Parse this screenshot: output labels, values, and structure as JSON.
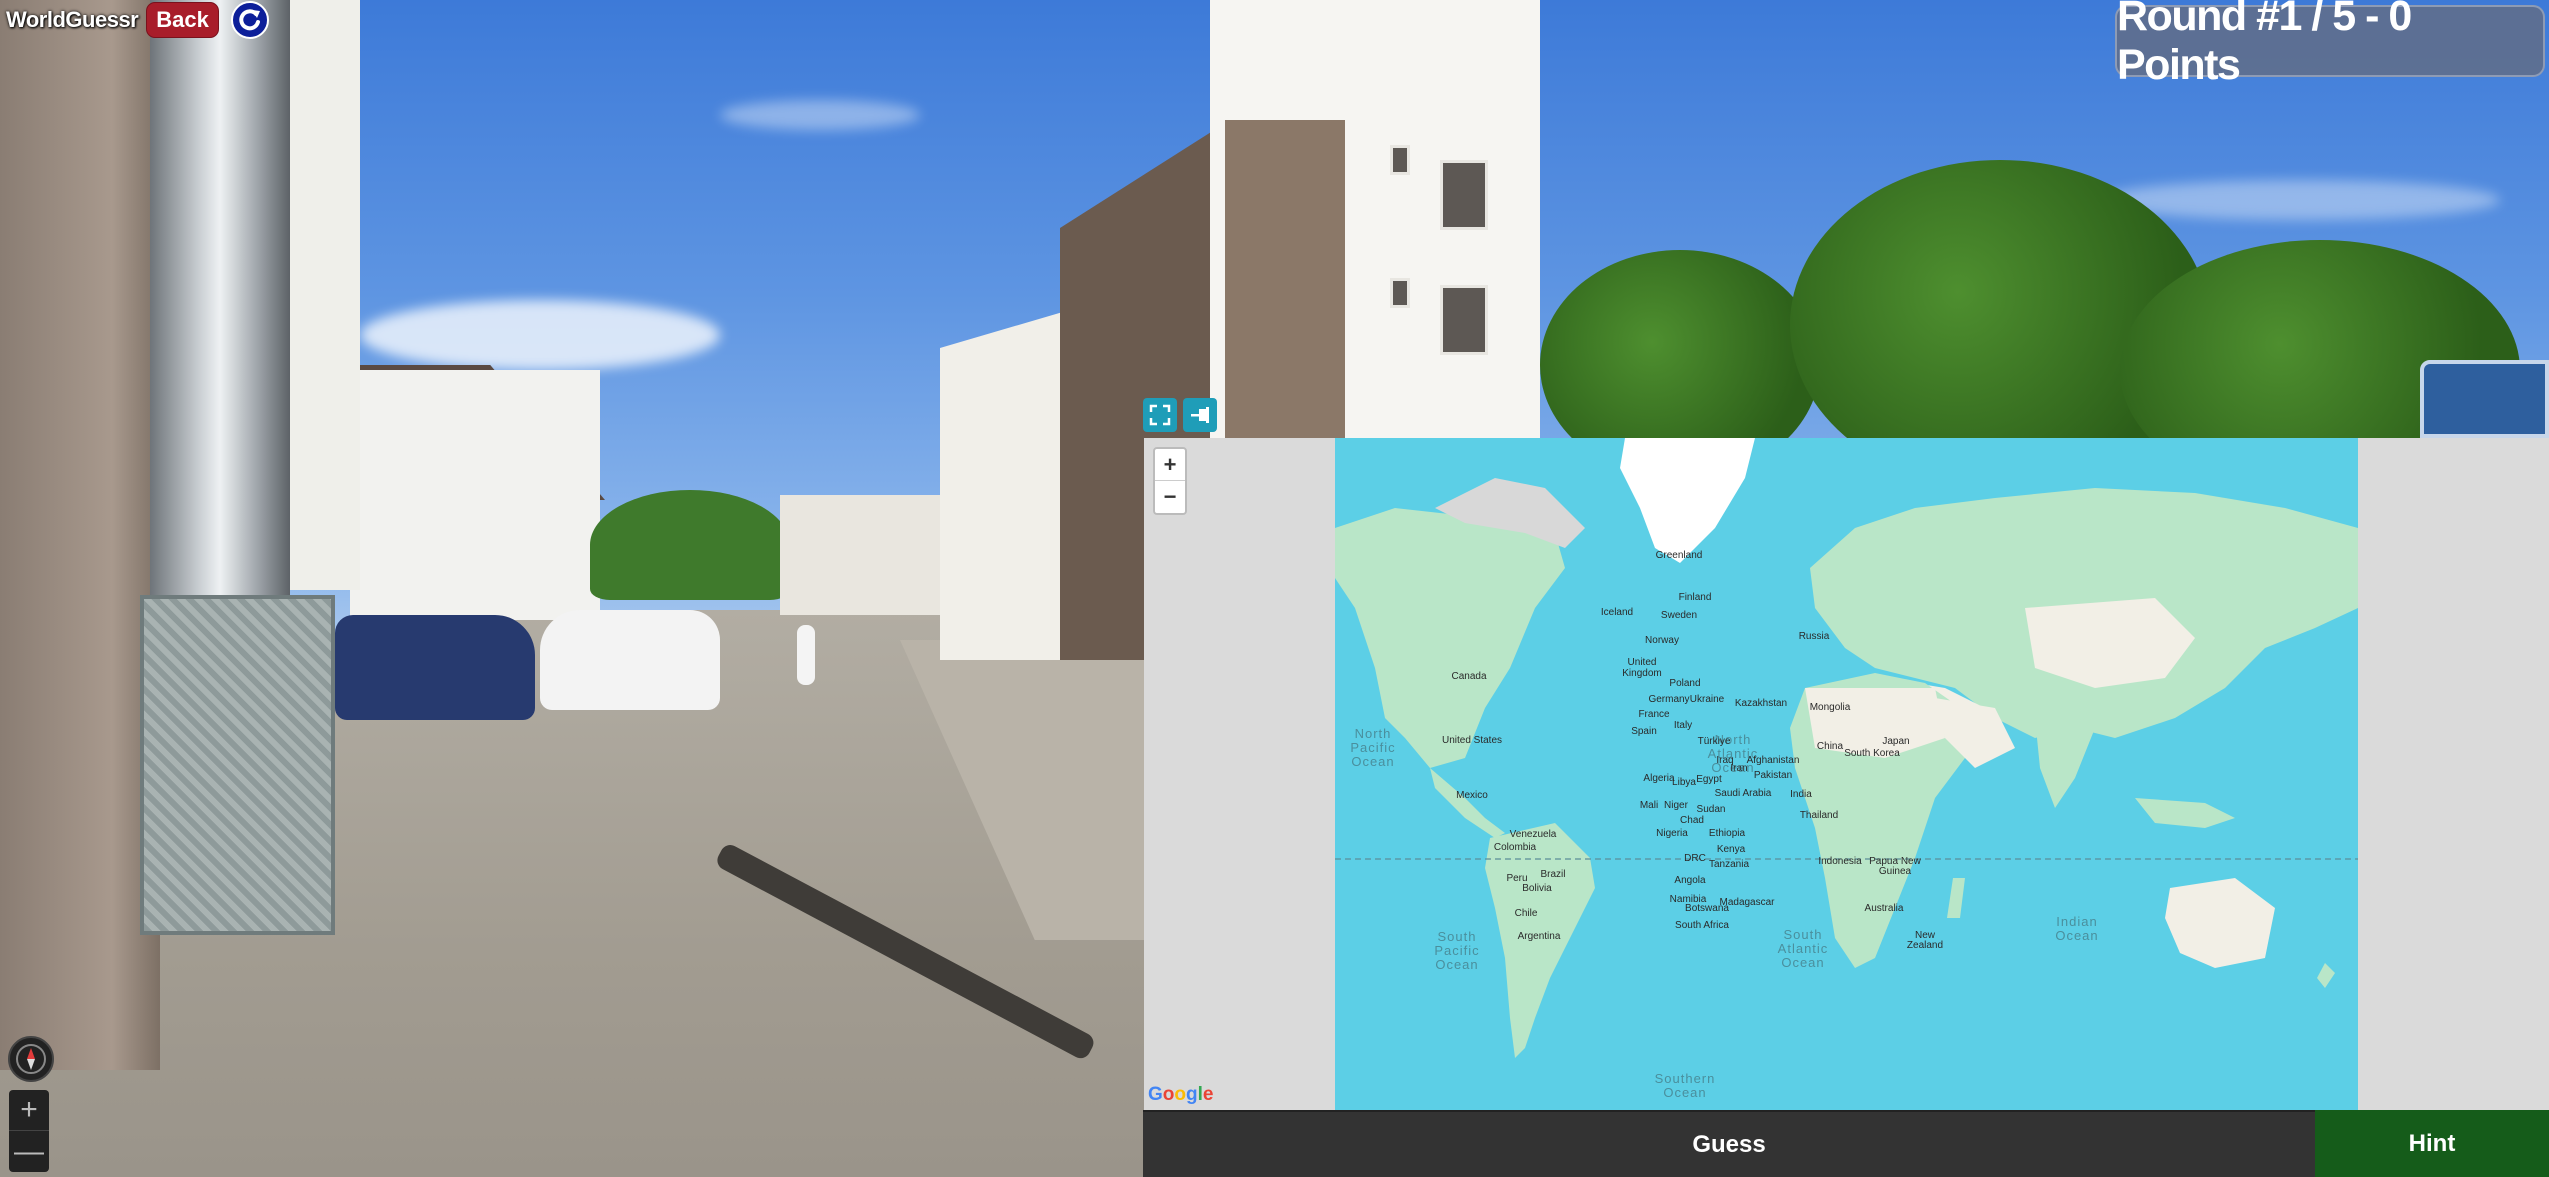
{
  "navbar": {
    "brand": "WorldGuessr",
    "back_label": "Back",
    "refresh_icon": "refresh-icon"
  },
  "round": {
    "label": "Round #1 / 5 - 0 Points"
  },
  "map": {
    "zoom_in": "+",
    "zoom_out": "−",
    "tools": [
      "fullscreen-icon",
      "pin-icon"
    ],
    "attribution": [
      "G",
      "o",
      "o",
      "g",
      "l",
      "e"
    ],
    "oceans": {
      "north_pacific": [
        "North",
        "Pacific",
        "Ocean"
      ],
      "north_atlantic": [
        "North",
        "Atlantic",
        "Ocean"
      ],
      "south_pacific": [
        "South",
        "Pacific",
        "Ocean"
      ],
      "south_atlantic": [
        "South",
        "Atlantic",
        "Ocean"
      ],
      "indian": [
        "Indian",
        "Ocean"
      ],
      "southern": [
        "Southern",
        "Ocean"
      ]
    },
    "countries": {
      "greenland": "Greenland",
      "iceland": "Iceland",
      "finland": "Finland",
      "sweden": "Sweden",
      "norway": "Norway",
      "russia": "Russia",
      "united_kingdom_1": "United",
      "united_kingdom_2": "Kingdom",
      "poland": "Poland",
      "germany": "Germany",
      "ukraine": "Ukraine",
      "france": "France",
      "kazakhstan": "Kazakhstan",
      "mongolia": "Mongolia",
      "spain": "Spain",
      "italy": "Italy",
      "turkiye": "Türkiye",
      "china": "China",
      "south_korea": "South Korea",
      "japan": "Japan",
      "canada": "Canada",
      "united_states": "United States",
      "mexico": "Mexico",
      "iraq": "Iraq",
      "iran": "Iran",
      "afghanistan": "Afghanistan",
      "pakistan": "Pakistan",
      "algeria": "Algeria",
      "libya": "Libya",
      "egypt": "Egypt",
      "saudi_arabia": "Saudi Arabia",
      "india": "India",
      "thailand": "Thailand",
      "mali": "Mali",
      "niger": "Niger",
      "sudan": "Sudan",
      "chad": "Chad",
      "nigeria": "Nigeria",
      "ethiopia": "Ethiopia",
      "venezuela": "Venezuela",
      "colombia": "Colombia",
      "kenya": "Kenya",
      "drc": "DRC",
      "tanzania": "Tanzania",
      "indonesia": "Indonesia",
      "papua_new_guinea_1": "Papua New",
      "papua_new_guinea_2": "Guinea",
      "brazil": "Brazil",
      "peru": "Peru",
      "bolivia": "Bolivia",
      "angola": "Angola",
      "namibia": "Namibia",
      "botswana": "Botswana",
      "madagascar": "Madagascar",
      "chile": "Chile",
      "south_africa": "South Africa",
      "australia": "Australia",
      "argentina": "Argentina",
      "new_zealand_1": "New",
      "new_zealand_2": "Zealand"
    }
  },
  "actions": {
    "guess_label": "Guess",
    "hint_label": "Hint"
  },
  "streetview": {
    "zoom_in": "+",
    "zoom_out": "—",
    "compass_icon": "compass-icon"
  },
  "colors": {
    "back": "#a81d2a",
    "refresh": "#0d1f9a",
    "guess": "#333333",
    "hint": "#155c1a",
    "ocean": "#5ccfe6",
    "land": "#b9e6c8"
  }
}
